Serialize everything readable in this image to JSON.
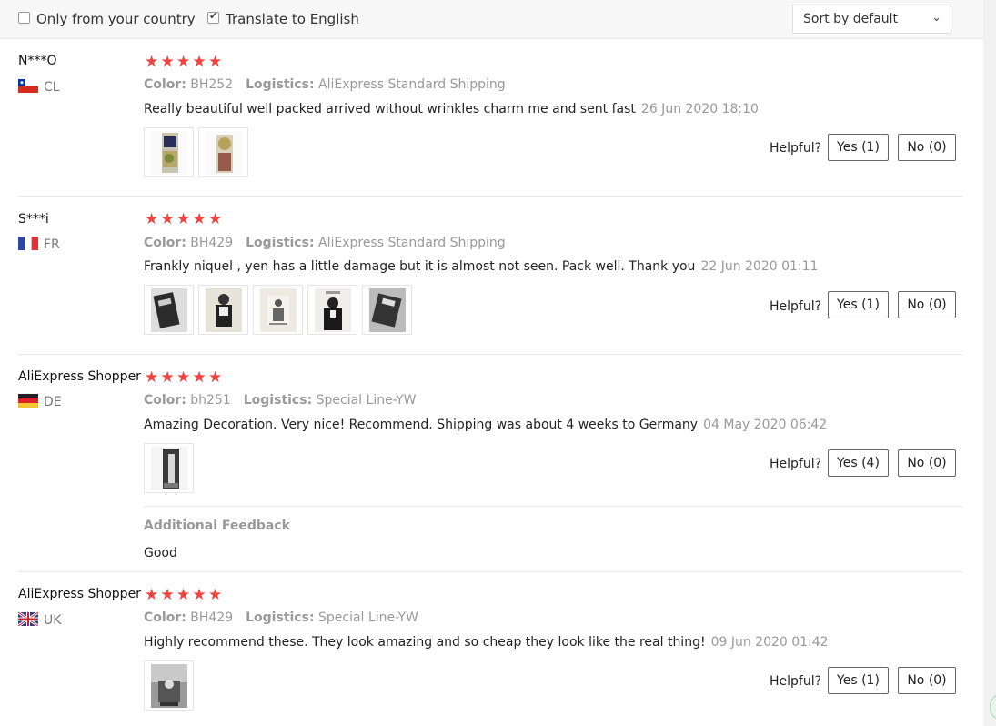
{
  "filters": {
    "only_country_label": "Only from your country",
    "only_country_checked": false,
    "translate_label": "Translate to English",
    "translate_checked": true,
    "sort_value": "Sort by default"
  },
  "reviews": [
    {
      "user": "N***O",
      "country_code": "CL",
      "flag_icon": "chile-flag-icon",
      "rating": 5,
      "color_label": "Color:",
      "color_value": "BH252",
      "logistics_label": "Logistics:",
      "logistics_value": "AliExpress Standard Shipping",
      "text": "Really beautiful well packed arrived without wrinkles charm me and sent fast",
      "date": "26 Jun 2020 18:10",
      "helpful_label": "Helpful?",
      "yes_label": "Yes (1)",
      "no_label": "No (0)",
      "photos": 2
    },
    {
      "user": "S***i",
      "country_code": "FR",
      "flag_icon": "france-flag-icon",
      "rating": 5,
      "color_label": "Color:",
      "color_value": "BH429",
      "logistics_label": "Logistics:",
      "logistics_value": "AliExpress Standard Shipping",
      "text": "Frankly niquel , yen has a little damage but it is almost not seen. Pack well. Thank you",
      "date": "22 Jun 2020 01:11",
      "helpful_label": "Helpful?",
      "yes_label": "Yes (1)",
      "no_label": "No (0)",
      "photos": 5
    },
    {
      "user": "AliExpress Shopper",
      "country_code": "DE",
      "flag_icon": "germany-flag-icon",
      "rating": 5,
      "color_label": "Color:",
      "color_value": "bh251",
      "logistics_label": "Logistics:",
      "logistics_value": "Special Line-YW",
      "text": "Amazing Decoration. Very nice! Recommend. Shipping was about 4 weeks to Germany",
      "date": "04 May 2020 06:42",
      "helpful_label": "Helpful?",
      "yes_label": "Yes (4)",
      "no_label": "No (0)",
      "photos": 1,
      "additional_title": "Additional Feedback",
      "additional_text": "Good"
    },
    {
      "user": "AliExpress Shopper",
      "country_code": "UK",
      "flag_icon": "uk-flag-icon",
      "rating": 5,
      "color_label": "Color:",
      "color_value": "BH429",
      "logistics_label": "Logistics:",
      "logistics_value": "Special Line-YW",
      "text": "Highly recommend these. They look amazing and so cheap they look like the real thing!",
      "date": "09 Jun 2020 01:42",
      "helpful_label": "Helpful?",
      "yes_label": "Yes (1)",
      "no_label": "No (0)",
      "photos": 1
    }
  ],
  "colors": {
    "star": "#f0433f",
    "muted": "#999999",
    "divider": "#e8e8e8"
  }
}
